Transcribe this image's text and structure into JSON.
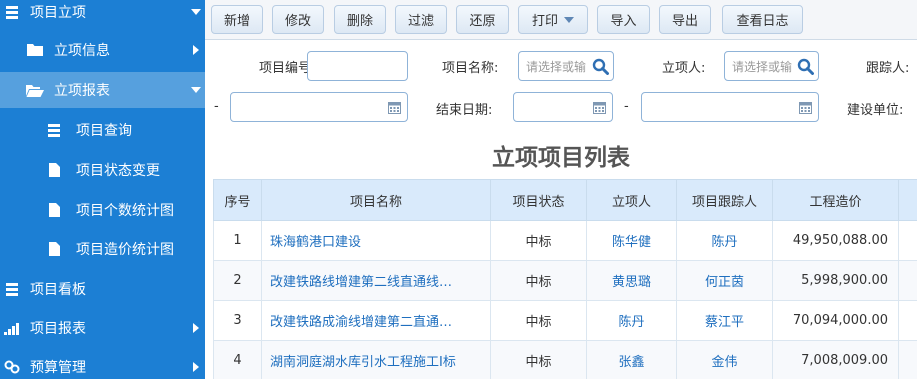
{
  "sidebar": {
    "items": [
      {
        "label": "项目立项",
        "icon": "list-icon",
        "arrow": "down"
      },
      {
        "label": "立项信息",
        "icon": "folder-icon",
        "arrow": "right"
      },
      {
        "label": "立项报表",
        "icon": "folder-open-icon",
        "arrow": "down"
      },
      {
        "label": "项目查询",
        "icon": "list-icon"
      },
      {
        "label": "项目状态变更",
        "icon": "file-icon"
      },
      {
        "label": "项目个数统计图",
        "icon": "file-icon"
      },
      {
        "label": "项目造价统计图",
        "icon": "file-icon"
      },
      {
        "label": "项目看板",
        "icon": "list-icon"
      },
      {
        "label": "项目报表",
        "icon": "signal-icon",
        "arrow": "right"
      },
      {
        "label": "预算管理",
        "icon": "link-icon",
        "arrow": "right"
      }
    ]
  },
  "toolbar": {
    "buttons": [
      "新增",
      "修改",
      "删除",
      "过滤",
      "还原",
      "打印",
      "导入",
      "导出",
      "查看日志"
    ]
  },
  "filters": {
    "project_code_label": "项目编号:",
    "project_code_value": "",
    "project_name_label": "项目名称:",
    "project_name_placeholder": "请选择或输",
    "creator_label": "立项人:",
    "creator_placeholder": "请选择或输",
    "tracker_label": "跟踪人:",
    "dash1": "-",
    "end_date_label": "结束日期:",
    "dash2": "-",
    "build_unit_label": "建设单位:"
  },
  "table": {
    "title": "立项项目列表",
    "columns": [
      "序号",
      "项目名称",
      "项目状态",
      "立项人",
      "项目跟踪人",
      "工程造价"
    ],
    "rows": [
      {
        "no": "1",
        "name": "珠海鹤港口建设",
        "status": "中标",
        "creator": "陈华健",
        "tracker": "陈丹",
        "cost": "49,950,088.00"
      },
      {
        "no": "2",
        "name": "改建铁路线增建第二线直通线…",
        "status": "中标",
        "creator": "黄思璐",
        "tracker": "何正茵",
        "cost": "5,998,900.00"
      },
      {
        "no": "3",
        "name": "改建铁路成渝线增建第二直通…",
        "status": "中标",
        "creator": "陈丹",
        "tracker": "蔡江平",
        "cost": "70,094,000.00"
      },
      {
        "no": "4",
        "name": "湖南洞庭湖水库引水工程施工I标",
        "status": "中标",
        "creator": "张鑫",
        "tracker": "金伟",
        "cost": "7,008,009.00"
      }
    ]
  },
  "colors": {
    "sidebar": "#1c7fd4",
    "sidebar_active": "#56a0de",
    "header": "#d9eafb",
    "link": "#1f6fbf"
  }
}
